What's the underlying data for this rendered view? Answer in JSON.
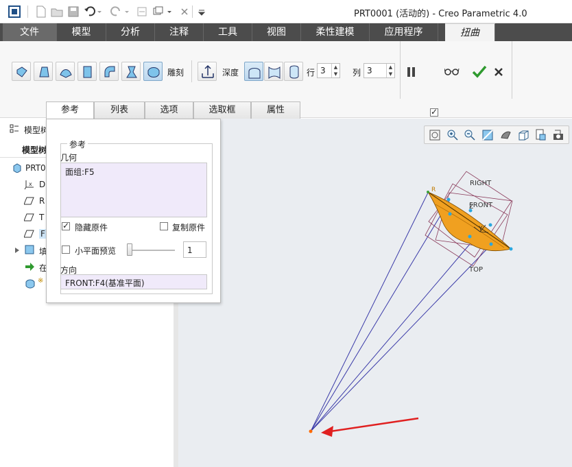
{
  "window": {
    "title": "PRT0001 (活动的) - Creo Parametric 4.0"
  },
  "ribbon_tabs": [
    {
      "label": "文件"
    },
    {
      "label": "模型"
    },
    {
      "label": "分析"
    },
    {
      "label": "注释"
    },
    {
      "label": "工具"
    },
    {
      "label": "视图"
    },
    {
      "label": "柔性建模"
    },
    {
      "label": "应用程序"
    },
    {
      "label": "扭曲"
    }
  ],
  "ribbon": {
    "sculpt_label": "雕刻",
    "depth_label": "深度",
    "rows_label": "行",
    "rows_value": "3",
    "cols_label": "列",
    "cols_value": "3"
  },
  "sub_tabs": [
    {
      "label": "参考"
    },
    {
      "label": "列表"
    },
    {
      "label": "选项"
    },
    {
      "label": "选取框"
    },
    {
      "label": "属性"
    }
  ],
  "panel": {
    "group_title": "参考",
    "geometry_label": "几何",
    "geometry_value": "面组:F5",
    "hide_original_label": "隐藏原件",
    "hide_original_checked": true,
    "copy_original_label": "复制原件",
    "copy_original_checked": false,
    "facet_preview_label": "小平面预览",
    "facet_preview_checked": false,
    "facet_value": "1",
    "direction_label": "方向",
    "direction_value": "FRONT:F4(基准平面)"
  },
  "model_tree": {
    "header": "模型树",
    "subheader": "模型树",
    "items": [
      {
        "label": "PRT0",
        "icon": "part-icon"
      },
      {
        "label": "D",
        "icon": "csys-icon"
      },
      {
        "label": "R",
        "icon": "plane-icon"
      },
      {
        "label": "T",
        "icon": "plane-icon"
      },
      {
        "label": "F",
        "icon": "plane-icon"
      },
      {
        "label": "填",
        "icon": "fill-icon"
      },
      {
        "label": "在",
        "icon": "insert-arrow-icon"
      },
      {
        "label": "※",
        "icon": "warp-feature-icon"
      }
    ]
  },
  "viewport": {
    "plane_labels": {
      "right": "RIGHT",
      "front": "FRONT",
      "top": "TOP"
    }
  },
  "colors": {
    "accent": "#4c4c4c",
    "model_fill": "#f0a020",
    "wire": "#3a3aa8",
    "arrow": "#e02020"
  }
}
